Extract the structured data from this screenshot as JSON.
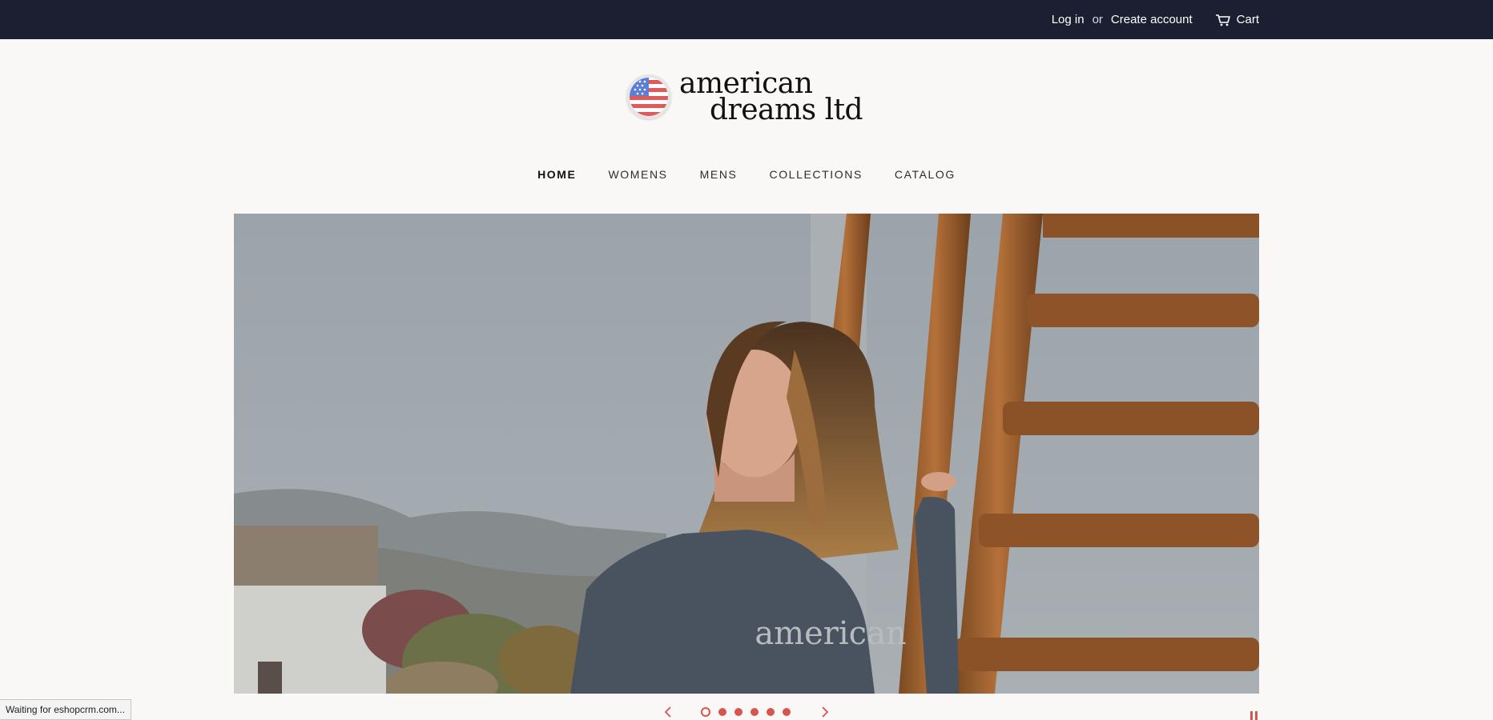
{
  "header": {
    "login_label": "Log in",
    "or_text": "or",
    "create_account_label": "Create account",
    "cart_label": "Cart",
    "cart_icon": "cart-icon",
    "background_color": "#1c1e31"
  },
  "logo": {
    "line1": "american",
    "line2": "dreams ltd",
    "badge_icon": "us-flag-icon"
  },
  "nav": {
    "items": [
      {
        "label": "HOME",
        "active": true
      },
      {
        "label": "WOMENS",
        "active": false
      },
      {
        "label": "MENS",
        "active": false
      },
      {
        "label": "COLLECTIONS",
        "active": false
      },
      {
        "label": "CATALOG",
        "active": false
      }
    ]
  },
  "hero": {
    "hoodie_text": "american",
    "slide_count": 6,
    "active_slide": 1
  },
  "slider": {
    "prev_icon": "chevron-left-icon",
    "next_icon": "chevron-right-icon",
    "pause_icon": "pause-icon",
    "accent_color": "#d9534f"
  },
  "status_bar": {
    "text": "Waiting for eshopcrm.com..."
  }
}
